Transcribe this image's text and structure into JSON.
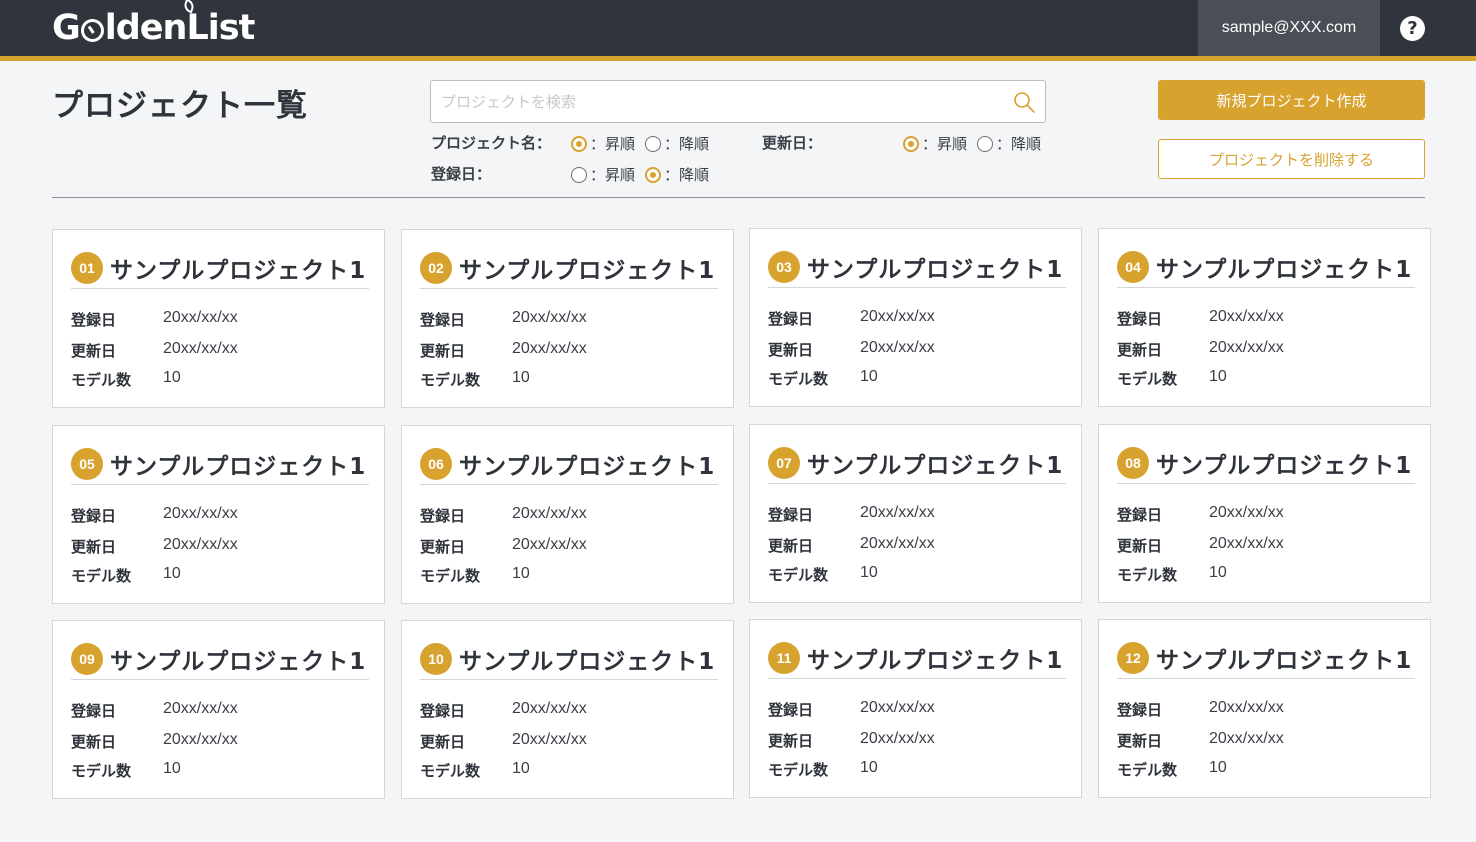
{
  "header": {
    "logo_text": "GoldenList",
    "account_email": "sample@XXX.com",
    "help_symbol": "?"
  },
  "page": {
    "title": "プロジェクト一覧"
  },
  "search": {
    "placeholder": "プロジェクトを検索"
  },
  "sort": {
    "asc_label": "：昇順",
    "desc_label": "：降順",
    "project_name_label": "プロジェクト名：",
    "updated_label": "更新日：",
    "registered_label": "登録日：",
    "project_name_selected": "asc",
    "updated_selected": "asc",
    "registered_selected": "desc"
  },
  "actions": {
    "new_project": "新規プロジェクト作成",
    "delete_project": "プロジェクトを削除する"
  },
  "card_labels": {
    "registered": "登録日",
    "updated": "更新日",
    "model_count": "モデル数"
  },
  "projects": [
    {
      "num": "01",
      "name": "サンプルプロジェクト1",
      "registered": "20xx/xx/xx",
      "updated": "20xx/xx/xx",
      "models": "10"
    },
    {
      "num": "02",
      "name": "サンプルプロジェクト1",
      "registered": "20xx/xx/xx",
      "updated": "20xx/xx/xx",
      "models": "10"
    },
    {
      "num": "03",
      "name": "サンプルプロジェクト1",
      "registered": "20xx/xx/xx",
      "updated": "20xx/xx/xx",
      "models": "10"
    },
    {
      "num": "04",
      "name": "サンプルプロジェクト1",
      "registered": "20xx/xx/xx",
      "updated": "20xx/xx/xx",
      "models": "10"
    },
    {
      "num": "05",
      "name": "サンプルプロジェクト1",
      "registered": "20xx/xx/xx",
      "updated": "20xx/xx/xx",
      "models": "10"
    },
    {
      "num": "06",
      "name": "サンプルプロジェクト1",
      "registered": "20xx/xx/xx",
      "updated": "20xx/xx/xx",
      "models": "10"
    },
    {
      "num": "07",
      "name": "サンプルプロジェクト1",
      "registered": "20xx/xx/xx",
      "updated": "20xx/xx/xx",
      "models": "10"
    },
    {
      "num": "08",
      "name": "サンプルプロジェクト1",
      "registered": "20xx/xx/xx",
      "updated": "20xx/xx/xx",
      "models": "10"
    },
    {
      "num": "09",
      "name": "サンプルプロジェクト1",
      "registered": "20xx/xx/xx",
      "updated": "20xx/xx/xx",
      "models": "10"
    },
    {
      "num": "10",
      "name": "サンプルプロジェクト1",
      "registered": "20xx/xx/xx",
      "updated": "20xx/xx/xx",
      "models": "10"
    },
    {
      "num": "11",
      "name": "サンプルプロジェクト1",
      "registered": "20xx/xx/xx",
      "updated": "20xx/xx/xx",
      "models": "10"
    },
    {
      "num": "12",
      "name": "サンプルプロジェクト1",
      "registered": "20xx/xx/xx",
      "updated": "20xx/xx/xx",
      "models": "10"
    }
  ],
  "colors": {
    "accent": "#d7a22e",
    "header_bg": "#30343c",
    "page_bg": "#f4f5f7"
  }
}
